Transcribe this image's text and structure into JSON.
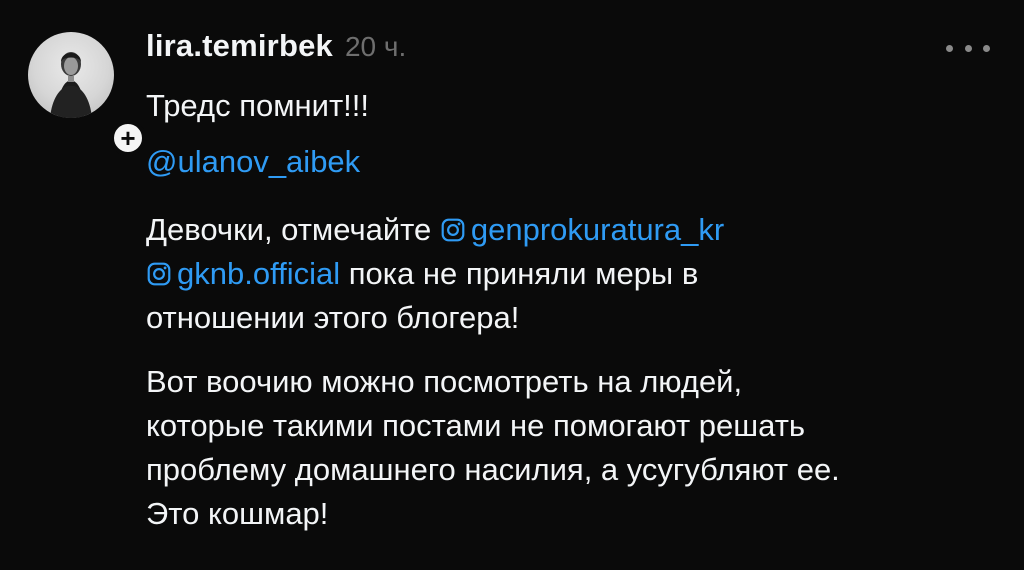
{
  "post": {
    "username": "lira.temirbek",
    "timestamp": "20 ч.",
    "follow_symbol": "+",
    "line1": "Тредс помнит!!!",
    "mention": "@ulanov_aibek",
    "p2_text1": "Девочки, отмечайте ",
    "p2_link1": "genprokuratura_kr",
    "p2_link2": "gknb.official",
    "p2_text2": " пока не приняли меры в",
    "p2_text3": "отношении этого блогера!",
    "p3_line1": "Вот воочию можно посмотреть на людей,",
    "p3_line2": "которые такими постами не помогают решать",
    "p3_line3": "проблему домашнего насилия, а усугубляют ее.",
    "p3_line4": "Это кошмар!"
  },
  "colors": {
    "background": "#0a0a0a",
    "text": "#f3f5f7",
    "muted": "#6e6e6e",
    "link": "#2f9bf4"
  },
  "icons": {
    "more": "more-horizontal-icon",
    "instagram": "instagram-icon",
    "follow": "plus-icon"
  }
}
